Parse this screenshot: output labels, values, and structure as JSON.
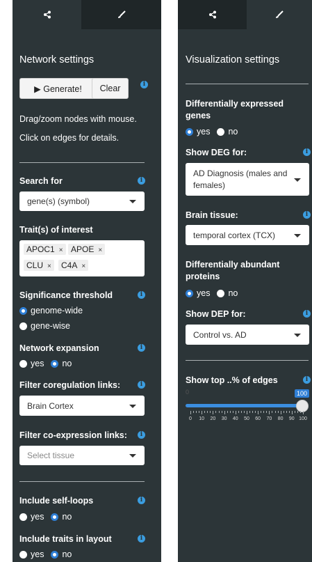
{
  "left": {
    "title": "Network settings",
    "generate_label": "▶ Generate!",
    "clear_label": "Clear",
    "hint1": "Drag/zoom nodes with mouse.",
    "hint2": "Click on edges for details.",
    "search_for": {
      "label": "Search for",
      "value": "gene(s) (symbol)"
    },
    "traits": {
      "label": "Trait(s) of interest",
      "tags": [
        "APOC1",
        "APOE",
        "CLU",
        "C4A"
      ],
      "remove_glyph": "×"
    },
    "significance": {
      "label": "Significance threshold",
      "options": [
        "genome-wide",
        "gene-wise"
      ],
      "selected": "genome-wide"
    },
    "expansion": {
      "label": "Network expansion",
      "options": [
        "yes",
        "no"
      ],
      "selected": "no"
    },
    "coregulation": {
      "label": "Filter coregulation links:",
      "value": "Brain Cortex"
    },
    "coexpression": {
      "label": "Filter co-expression links:",
      "placeholder": "Select tissue"
    },
    "self_loops": {
      "label": "Include self-loops",
      "options": [
        "yes",
        "no"
      ],
      "selected": "no"
    },
    "traits_layout": {
      "label": "Include traits in layout",
      "options": [
        "yes",
        "no"
      ],
      "selected": "no"
    }
  },
  "right": {
    "title": "Visualization settings",
    "deg": {
      "label": "Differentially expressed genes",
      "options": [
        "yes",
        "no"
      ],
      "selected": "yes"
    },
    "show_deg": {
      "label": "Show DEG for:",
      "value": "AD Diagnosis (males and females)"
    },
    "tissue": {
      "label": "Brain tissue:",
      "value": "temporal cortex (TCX)"
    },
    "dap": {
      "label": "Differentially abundant proteins",
      "options": [
        "yes",
        "no"
      ],
      "selected": "yes"
    },
    "show_dep": {
      "label": "Show DEP for:",
      "value": "Control vs. AD"
    },
    "edges": {
      "label": "Show top ..% of edges",
      "value": 100,
      "min_label": "0",
      "max_label": "100",
      "ticks": [
        "0",
        "10",
        "20",
        "30",
        "40",
        "50",
        "60",
        "70",
        "80",
        "90",
        "100"
      ]
    }
  },
  "colors": {
    "panel": "#2c3538",
    "accent": "#2f7fd6",
    "info": "#3b9de0"
  },
  "icons": {
    "tab1": "share-icon",
    "tab2": "paintbrush-icon",
    "info": "info-icon"
  }
}
